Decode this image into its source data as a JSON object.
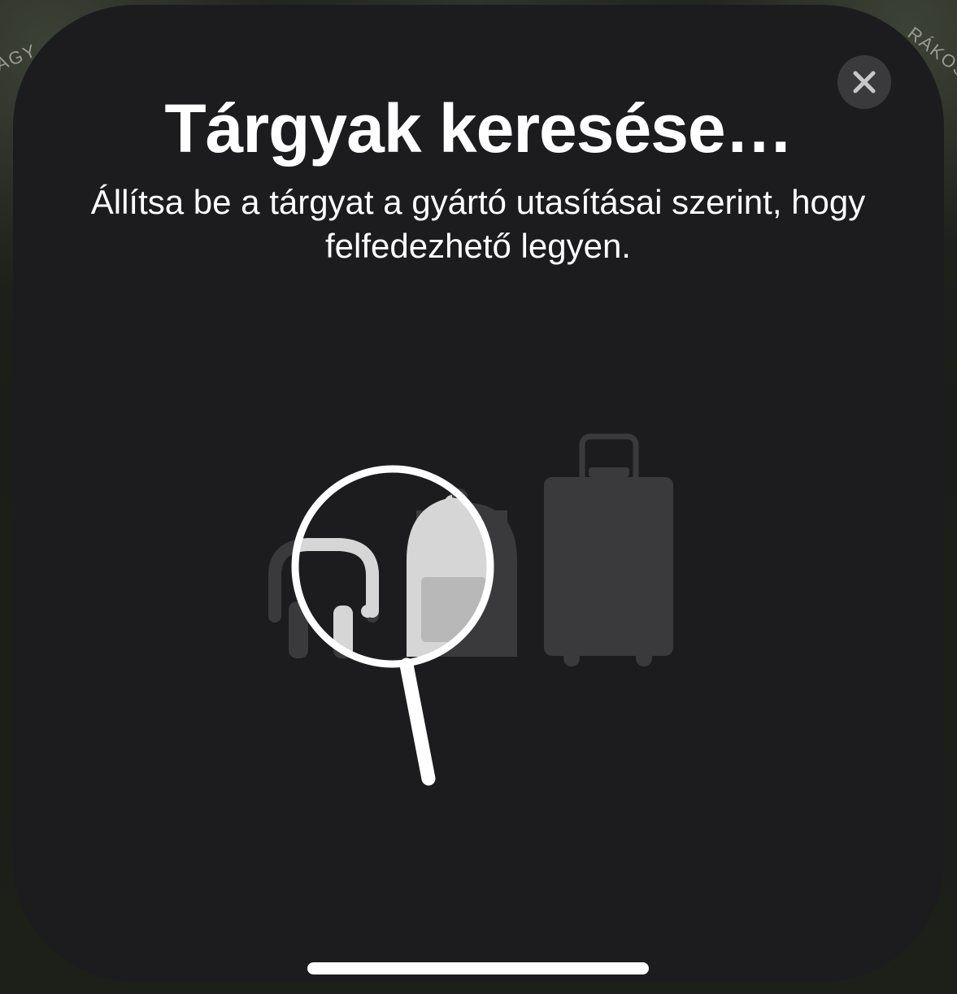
{
  "map": {
    "label_left": "AGY",
    "label_right": "RÁKOS"
  },
  "sheet": {
    "title": "Tárgyak keresése…",
    "subtitle": "Állítsa be a tárgyat a gyártó utasításai szerint, hogy felfedezhető legyen.",
    "close_icon": "xmark-icon",
    "illustration_icons": [
      "headphones-icon",
      "backpack-icon",
      "suitcase-icon",
      "magnifying-glass-icon"
    ]
  },
  "colors": {
    "sheet_background": "#1c1c1e",
    "close_button_background": "#3a3a3c",
    "text": "#ffffff",
    "illustration_dim": "#3a3a3c",
    "illustration_light": "#d6d6d6"
  }
}
